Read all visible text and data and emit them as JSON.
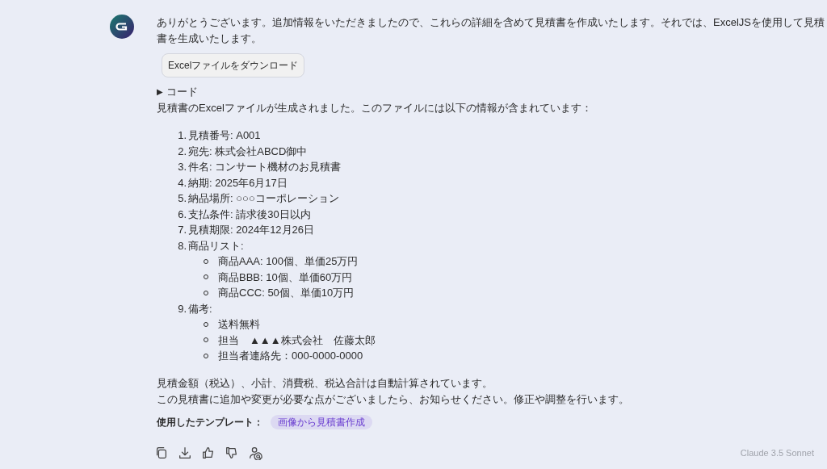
{
  "message": {
    "intro": "ありがとうございます。追加情報をいただきましたので、これらの詳細を含めて見積書を作成いたします。それでは、ExcelJSを使用して見積書を生成いたします。",
    "download_button": "Excelファイルをダウンロード",
    "code_toggle": {
      "arrow": "▶",
      "label": "コード",
      "expanded": false
    },
    "summary": "見積書のExcelファイルが生成されました。このファイルには以下の情報が含まれています：",
    "items": [
      {
        "number": "1.",
        "text": "見積番号: A001"
      },
      {
        "number": "2.",
        "text": "宛先: 株式会社ABCD御中"
      },
      {
        "number": "3.",
        "text": "件名: コンサート機材のお見積書"
      },
      {
        "number": "4.",
        "text": "納期: 2025年6月17日"
      },
      {
        "number": "5.",
        "text": "納品場所: ○○○コーポレーション"
      },
      {
        "number": "6.",
        "text": "支払条件: 請求後30日以内"
      },
      {
        "number": "7.",
        "text": "見積期限: 2024年12月26日"
      },
      {
        "number": "8.",
        "text": "商品リスト:",
        "children": [
          {
            "text": "商品AAA: 100個、単価25万円"
          },
          {
            "text": "商品BBB: 10個、単価60万円"
          },
          {
            "text": "商品CCC: 50個、単価10万円"
          }
        ]
      },
      {
        "number": "9.",
        "text": "備考:",
        "children": [
          {
            "text": "送料無料"
          },
          {
            "text": "担当　▲▲▲株式会社　佐藤太郎"
          },
          {
            "text": "担当者連絡先：000-0000-0000"
          }
        ]
      }
    ],
    "closing": [
      "見積金額（税込）、小計、消費税、税込合計は自動計算されています。",
      "この見積書に追加や変更が必要な点がございましたら、お知らせください。修正や調整を行います。"
    ],
    "template_label": "使用したテンプレート：",
    "template_tag": "画像から見積書作成",
    "actions": [
      {
        "kind": "copy"
      },
      {
        "kind": "download"
      },
      {
        "kind": "like"
      },
      {
        "kind": "dislike"
      },
      {
        "kind": "share"
      }
    ],
    "model": "Claude 3.5 Sonnet"
  }
}
